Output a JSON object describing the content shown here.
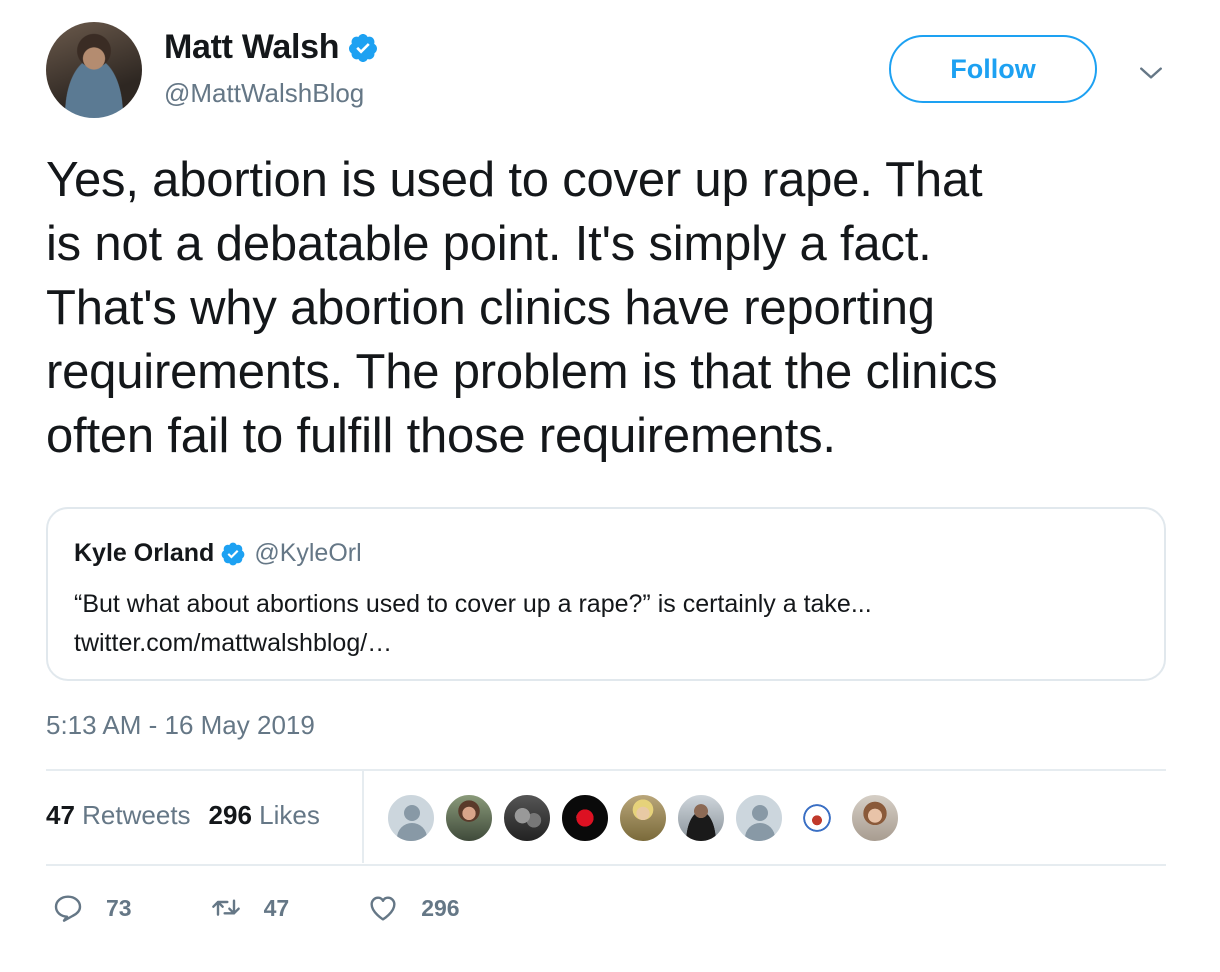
{
  "author": {
    "name": "Matt Walsh",
    "handle": "@MattWalshBlog",
    "verified": true
  },
  "follow_label": "Follow",
  "tweet_lines": [
    "Yes, abortion is used to cover up rape. That",
    "is not a debatable point. It's simply a fact.",
    "That's why abortion clinics have reporting",
    "requirements. The problem is that the clinics",
    "often fail to fulfill those requirements."
  ],
  "quote": {
    "name": "Kyle Orland",
    "handle": "@KyleOrl",
    "text": "“But what about abortions used to cover up a rape?” is certainly a take...",
    "link": "twitter.com/mattwalshblog/…"
  },
  "timestamp": "5:13 AM - 16 May 2019",
  "stats": {
    "retweets_count": "47",
    "retweets_label": "Retweets",
    "likes_count": "296",
    "likes_label": "Likes"
  },
  "actions": {
    "replies": "73",
    "retweets": "47",
    "likes": "296"
  },
  "colors": {
    "accent": "#1da1f2",
    "secondary_text": "#657786",
    "border": "#e1e8ed"
  },
  "icons": {
    "verified": "verified-badge-icon",
    "caret": "chevron-down-icon",
    "reply": "reply-icon",
    "retweet": "retweet-icon",
    "like": "heart-icon"
  }
}
